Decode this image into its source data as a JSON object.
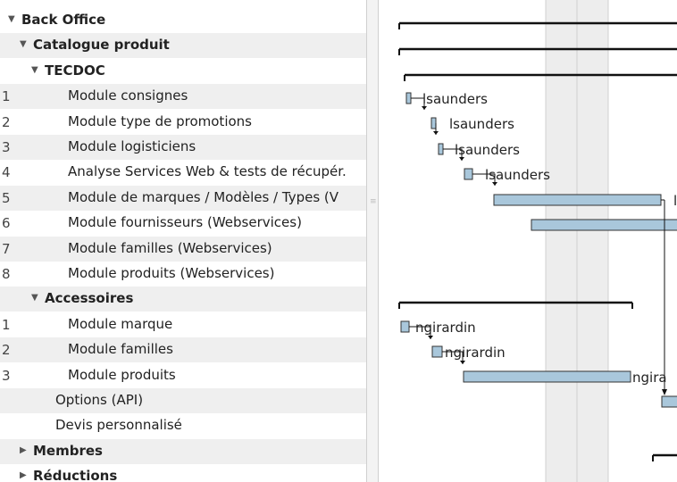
{
  "tree": {
    "rows": [
      {
        "num": "",
        "label": "Back Office",
        "indent": 0,
        "bold": true,
        "toggle": "expanded",
        "shaded": false
      },
      {
        "num": "",
        "label": "Catalogue produit",
        "indent": 1,
        "bold": true,
        "toggle": "expanded",
        "shaded": true
      },
      {
        "num": "",
        "label": "TECDOC",
        "indent": 2,
        "bold": true,
        "toggle": "expanded",
        "shaded": false
      },
      {
        "num": "1",
        "label": "Module consignes",
        "indent": 3,
        "bold": false,
        "toggle": "none",
        "shaded": true
      },
      {
        "num": "2",
        "label": "Module type de promotions",
        "indent": 3,
        "bold": false,
        "toggle": "none",
        "shaded": false
      },
      {
        "num": "3",
        "label": "Module logisticiens",
        "indent": 3,
        "bold": false,
        "toggle": "none",
        "shaded": true
      },
      {
        "num": "4",
        "label": "Analyse Services Web & tests de récupér.",
        "indent": 3,
        "bold": false,
        "toggle": "none",
        "shaded": false
      },
      {
        "num": "5",
        "label": "Module de marques / Modèles / Types (V",
        "indent": 3,
        "bold": false,
        "toggle": "none",
        "shaded": true
      },
      {
        "num": "6",
        "label": "Module fournisseurs (Webservices)",
        "indent": 3,
        "bold": false,
        "toggle": "none",
        "shaded": false
      },
      {
        "num": "7",
        "label": "Module familles (Webservices)",
        "indent": 3,
        "bold": false,
        "toggle": "none",
        "shaded": true
      },
      {
        "num": "8",
        "label": "Module produits (Webservices)",
        "indent": 3,
        "bold": false,
        "toggle": "none",
        "shaded": false
      },
      {
        "num": "",
        "label": "Accessoires",
        "indent": 2,
        "bold": true,
        "toggle": "expanded",
        "shaded": true
      },
      {
        "num": "1",
        "label": "Module marque",
        "indent": 3,
        "bold": false,
        "toggle": "none",
        "shaded": false
      },
      {
        "num": "2",
        "label": "Module familles",
        "indent": 3,
        "bold": false,
        "toggle": "none",
        "shaded": true
      },
      {
        "num": "3",
        "label": "Module produits",
        "indent": 3,
        "bold": false,
        "toggle": "none",
        "shaded": false
      },
      {
        "num": "",
        "label": "Options (API)",
        "indent": 2,
        "bold": false,
        "toggle": "none",
        "shaded": true
      },
      {
        "num": "",
        "label": "Devis personnalisé",
        "indent": 2,
        "bold": false,
        "toggle": "none",
        "shaded": false
      },
      {
        "num": "",
        "label": "Membres",
        "indent": 1,
        "bold": true,
        "toggle": "collapsed",
        "shaded": true
      },
      {
        "num": "",
        "label": "Réductions",
        "indent": 1,
        "bold": true,
        "toggle": "collapsed",
        "shaded": false
      }
    ]
  },
  "gantt": {
    "colors": {
      "bar": "#a9c7db",
      "bar_border": "#333333",
      "summary": "#111111",
      "weekend": "#ededed",
      "grid": "#d0d0d0"
    },
    "resources": [
      "lsaunders",
      "lsaunders",
      "lsaunders",
      "lsaunders",
      "l",
      "ngirardin",
      "ngirardin",
      "ngira"
    ]
  }
}
